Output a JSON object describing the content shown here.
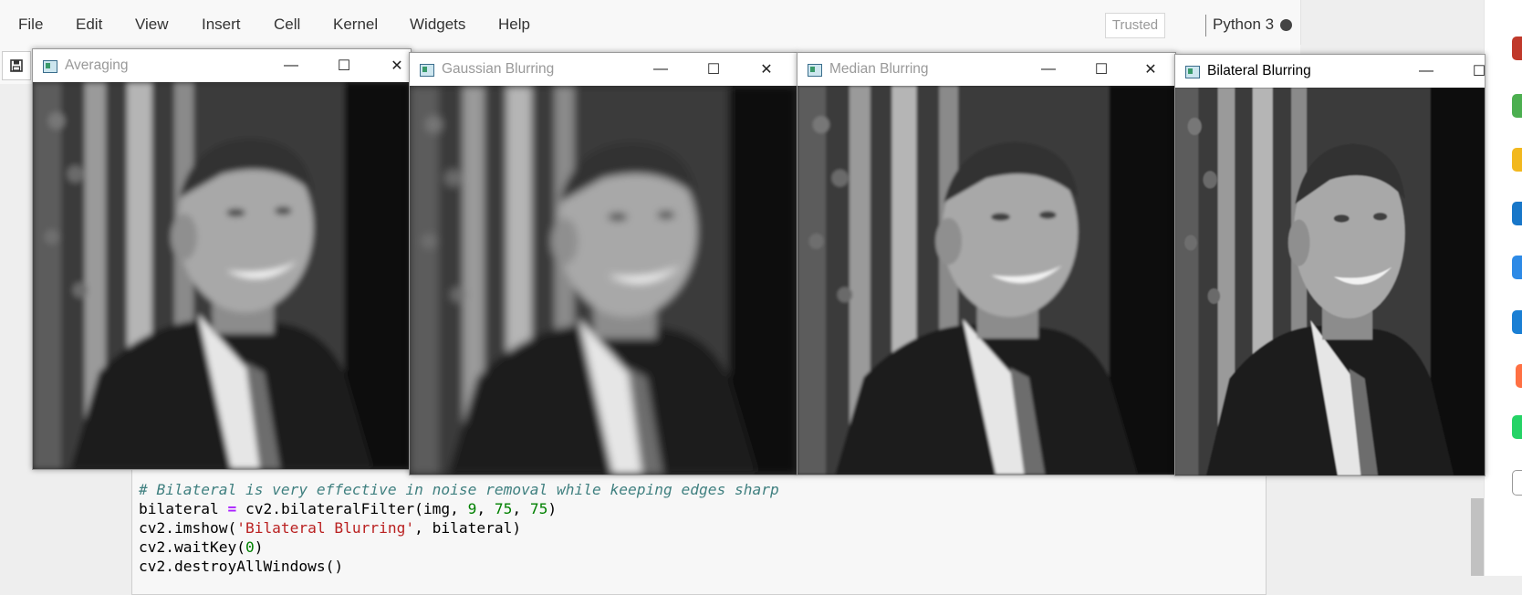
{
  "menubar": {
    "items": [
      "File",
      "Edit",
      "View",
      "Insert",
      "Cell",
      "Kernel",
      "Widgets",
      "Help"
    ],
    "trusted_label": "Trusted",
    "kernel_name": "Python 3"
  },
  "toolbar": {
    "save_icon": "floppy-disk-icon"
  },
  "code_cell": {
    "lines": [
      "# Bilateral is very effective in noise removal while keeping edges sharp",
      "bilateral = cv2.bilateralFilter(img, 9, 75, 75)",
      "cv2.imshow('Bilateral Blurring', bilateral)",
      "cv2.waitKey(0)",
      "cv2.destroyAllWindows()"
    ]
  },
  "windows": [
    {
      "title": "Averaging",
      "minimize": "—",
      "maximize": "☐",
      "close": "✕"
    },
    {
      "title": "Gaussian Blurring",
      "minimize": "—",
      "maximize": "☐",
      "close": "✕"
    },
    {
      "title": "Median Blurring",
      "minimize": "—",
      "maximize": "☐",
      "close": "✕"
    },
    {
      "title": "Bilateral Blurring",
      "minimize": "—",
      "maximize": "☐",
      "close": "✕"
    }
  ],
  "colors": {
    "comment": "#408080",
    "operator": "#aa22ff",
    "number": "#008000",
    "string": "#ba2121",
    "window_icon": "#3a6d8c"
  }
}
